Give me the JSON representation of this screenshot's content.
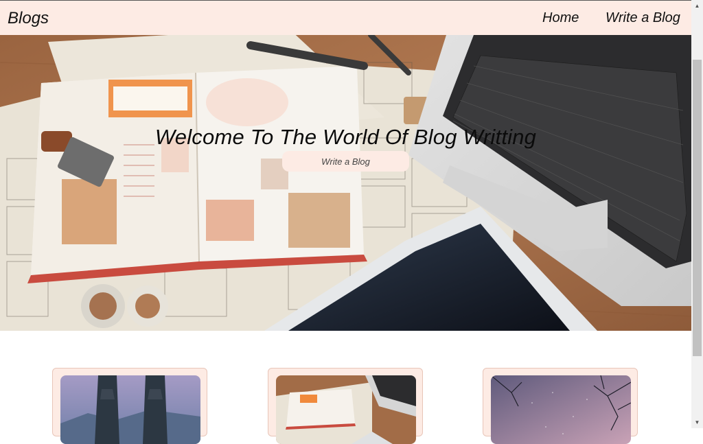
{
  "navbar": {
    "brand": "Blogs",
    "links": [
      {
        "label": "Home"
      },
      {
        "label": "Write a Blog"
      }
    ]
  },
  "hero": {
    "title": "Welcome To The World Of Blog Writting",
    "button_label": "Write a Blog",
    "image": "desk-with-journal-newspaper-laptop-tablet"
  },
  "cards": [
    {
      "image": "temple-gate-mountain-sky"
    },
    {
      "image": "desk-journal-laptop"
    },
    {
      "image": "starry-pink-sky-trees"
    }
  ],
  "colors": {
    "navbar_bg": "#fdebe4",
    "card_bg": "#fdebe4",
    "button_bg": "#fdebe4"
  }
}
